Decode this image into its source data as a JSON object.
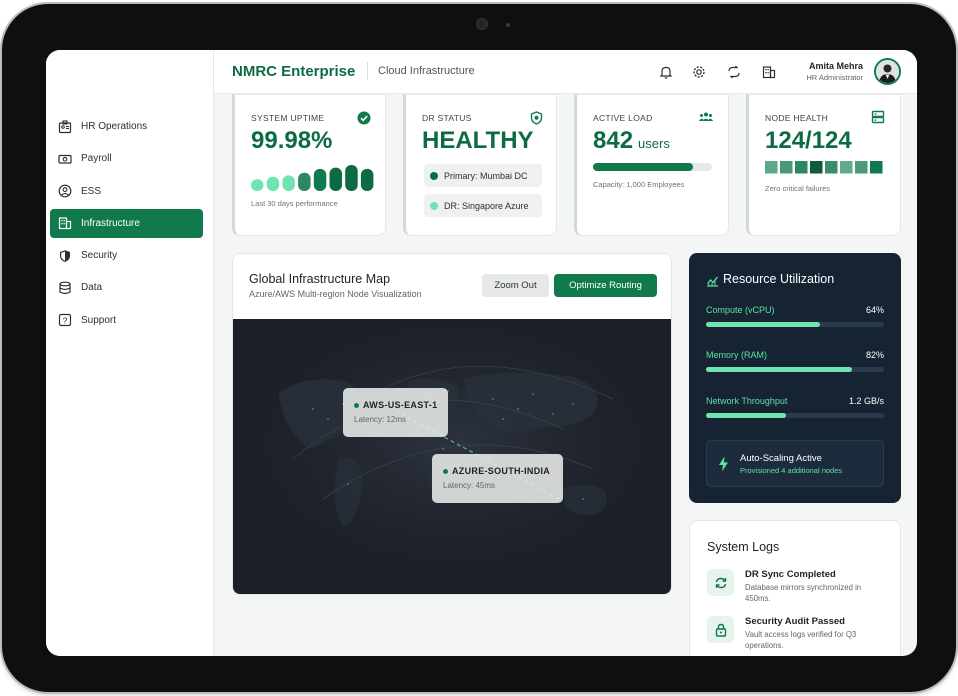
{
  "app": {
    "brand": "NMRC Enterprise",
    "section": "Cloud Infrastructure"
  },
  "user": {
    "name": "Amita Mehra",
    "role": "HR Administrator"
  },
  "header_icons": [
    "bell-icon",
    "gear-icon",
    "sync-icon",
    "building-icon"
  ],
  "sidebar": {
    "items": [
      {
        "label": "HR Operations",
        "icon": "id-badge-icon"
      },
      {
        "label": "Payroll",
        "icon": "banknote-icon"
      },
      {
        "label": "ESS",
        "icon": "user-circle-icon"
      },
      {
        "label": "Infrastructure",
        "icon": "building-icon",
        "active": true
      },
      {
        "label": "Security",
        "icon": "shield-icon"
      },
      {
        "label": "Data",
        "icon": "database-icon"
      },
      {
        "label": "Support",
        "icon": "help-icon"
      }
    ]
  },
  "stats": {
    "uptime": {
      "label": "SYSTEM UPTIME",
      "value": "99.98%",
      "note": "Last 30 days performance",
      "bars": [
        0.45,
        0.55,
        0.6,
        0.7,
        0.85,
        0.9,
        1.0,
        0.85
      ]
    },
    "dr": {
      "label": "DR STATUS",
      "value": "HEALTHY",
      "primary": "Primary: Mumbai DC",
      "secondary": "DR: Singapore Azure"
    },
    "load": {
      "label": "ACTIVE LOAD",
      "value": "842",
      "unit": "users",
      "note": "Capacity: 1,000 Employees",
      "fraction": 0.842
    },
    "health": {
      "label": "NODE HEALTH",
      "value": "124/124",
      "note": "Zero critical failures"
    }
  },
  "map": {
    "title": "Global Infrastructure Map",
    "subtitle": "Azure/AWS Multi-region Node Visualization",
    "zoom_out": "Zoom Out",
    "optimize": "Optimize Routing",
    "nodes": [
      {
        "name": "AWS-US-EAST-1",
        "latency": "Latency: 12ms"
      },
      {
        "name": "AZURE-SOUTH-INDIA",
        "latency": "Latency: 45ms"
      }
    ]
  },
  "resources": {
    "title": "Resource Utilization",
    "rows": [
      {
        "label": "Compute (vCPU)",
        "value": "64%",
        "fraction": 0.64
      },
      {
        "label": "Memory (RAM)",
        "value": "82%",
        "fraction": 0.82
      },
      {
        "label": "Network Throughput",
        "value": "1.2 GB/s",
        "fraction": 0.45
      }
    ],
    "auto_title": "Auto-Scaling Active",
    "auto_sub": "Provisioned 4 additional nodes"
  },
  "logs": {
    "title": "System Logs",
    "items": [
      {
        "title": "DR Sync Completed",
        "desc": "Database mirrors synchronized in 450ms."
      },
      {
        "title": "Security Audit Passed",
        "desc": "Vault access logs verified for Q3 operations."
      }
    ]
  },
  "colors": {
    "primary": "#117a4d",
    "accent": "#5ee3a3",
    "dark": "#152333"
  }
}
